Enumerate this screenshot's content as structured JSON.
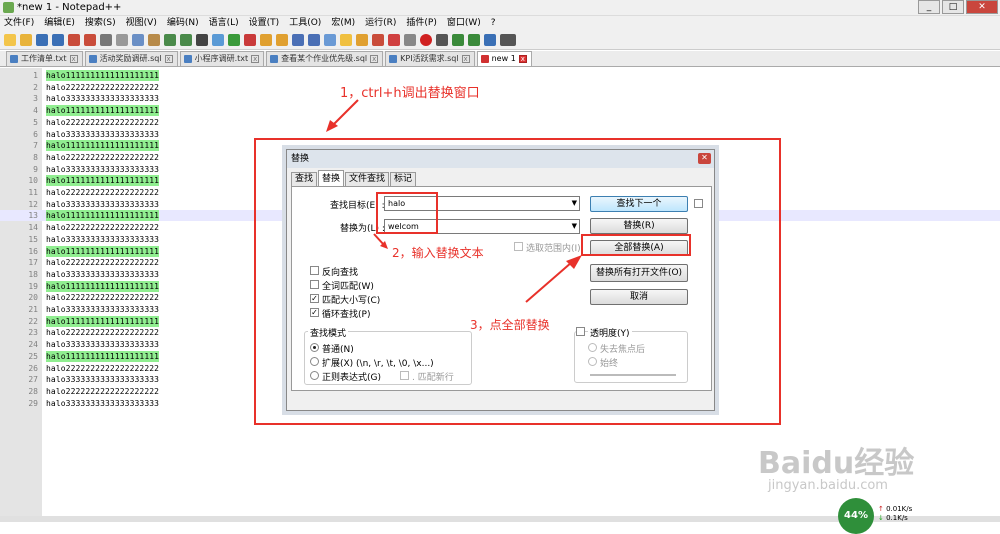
{
  "window": {
    "title": "*new 1 - Notepad++",
    "min": "_",
    "max": "□",
    "close": "✕"
  },
  "menu": [
    "文件(F)",
    "编辑(E)",
    "搜索(S)",
    "视图(V)",
    "编码(N)",
    "语言(L)",
    "设置(T)",
    "工具(O)",
    "宏(M)",
    "运行(R)",
    "插件(P)",
    "窗口(W)",
    "?"
  ],
  "tabs": [
    {
      "label": "工作清单.txt"
    },
    {
      "label": "活动奖励调研.sql"
    },
    {
      "label": "小程序调研.txt"
    },
    {
      "label": "查看某个作业优先级.sql"
    },
    {
      "label": "KPI活跃需求.sql"
    },
    {
      "label": "new 1"
    }
  ],
  "editor": {
    "current_line": 13,
    "lines": [
      {
        "n": "1",
        "text": "halo1111111111111111111",
        "hl": true
      },
      {
        "n": "2",
        "text": "halo2222222222222222222",
        "hl": false
      },
      {
        "n": "3",
        "text": "halo3333333333333333333",
        "hl": false
      },
      {
        "n": "4",
        "text": "halo1111111111111111111",
        "hl": true
      },
      {
        "n": "5",
        "text": "halo2222222222222222222",
        "hl": false
      },
      {
        "n": "6",
        "text": "halo3333333333333333333",
        "hl": false
      },
      {
        "n": "7",
        "text": "halo1111111111111111111",
        "hl": true
      },
      {
        "n": "8",
        "text": "halo2222222222222222222",
        "hl": false
      },
      {
        "n": "9",
        "text": "halo3333333333333333333",
        "hl": false
      },
      {
        "n": "10",
        "text": "halo1111111111111111111",
        "hl": true
      },
      {
        "n": "11",
        "text": "halo2222222222222222222",
        "hl": false
      },
      {
        "n": "12",
        "text": "halo3333333333333333333",
        "hl": false
      },
      {
        "n": "13",
        "text": "halo1111111111111111111",
        "hl": true
      },
      {
        "n": "14",
        "text": "halo2222222222222222222",
        "hl": false
      },
      {
        "n": "15",
        "text": "halo3333333333333333333",
        "hl": false
      },
      {
        "n": "16",
        "text": "halo1111111111111111111",
        "hl": true
      },
      {
        "n": "17",
        "text": "halo2222222222222222222",
        "hl": false
      },
      {
        "n": "18",
        "text": "halo3333333333333333333",
        "hl": false
      },
      {
        "n": "19",
        "text": "halo1111111111111111111",
        "hl": true
      },
      {
        "n": "20",
        "text": "halo2222222222222222222",
        "hl": false
      },
      {
        "n": "21",
        "text": "halo3333333333333333333",
        "hl": false
      },
      {
        "n": "22",
        "text": "halo1111111111111111111",
        "hl": true
      },
      {
        "n": "23",
        "text": "halo2222222222222222222",
        "hl": false
      },
      {
        "n": "24",
        "text": "halo3333333333333333333",
        "hl": false
      },
      {
        "n": "25",
        "text": "halo1111111111111111111",
        "hl": true
      },
      {
        "n": "26",
        "text": "halo2222222222222222222",
        "hl": false
      },
      {
        "n": "27",
        "text": "halo3333333333333333333",
        "hl": false
      },
      {
        "n": "28",
        "text": "halo2222222222222222222",
        "hl": false
      },
      {
        "n": "29",
        "text": "halo3333333333333333333",
        "hl": false
      }
    ]
  },
  "dialog": {
    "title": "替换",
    "close": "✕",
    "tabs": [
      "查找",
      "替换",
      "文件查找",
      "标记"
    ],
    "find_label": "查找目标(E) :",
    "find_value": "halo",
    "replace_label": "替换为(L) :",
    "replace_value": "welcom",
    "in_selection": "选取范围内(I)",
    "btn_find_next": "查找下一个",
    "btn_replace": "替换(R)",
    "btn_replace_all": "全部替换(A)",
    "btn_replace_all_open": "替换所有打开文件(O)",
    "btn_close": "取消",
    "opt_backward": "反向查找",
    "opt_whole_word": "全词匹配(W)",
    "opt_match_case": "匹配大小写(C)",
    "opt_wrap": "循环查找(P)",
    "mode_title": "查找模式",
    "mode_normal": "普通(N)",
    "mode_extended": "扩展(X) (\\n, \\r, \\t, \\0, \\x...)",
    "mode_regex": "正则表达式(G)",
    "opt_dot_newline": ". 匹配新行",
    "transparency": "透明度(Y)",
    "trans_on_lose": "失去焦点后",
    "trans_always": "始终"
  },
  "annotations": {
    "step1": "1，ctrl+h调出替换窗口",
    "step2": "2，输入替换文本",
    "step3": "3，点全部替换"
  },
  "watermark": {
    "logo": "Baidu经验",
    "url": "jingyan.baidu.com"
  },
  "net": {
    "percent": "44%",
    "up": "0.01K/s",
    "down": "0.1K/s"
  },
  "colors": {
    "annotation": "#e8312a",
    "highlight": "#90ee90",
    "current_line": "#e8e8ff"
  }
}
